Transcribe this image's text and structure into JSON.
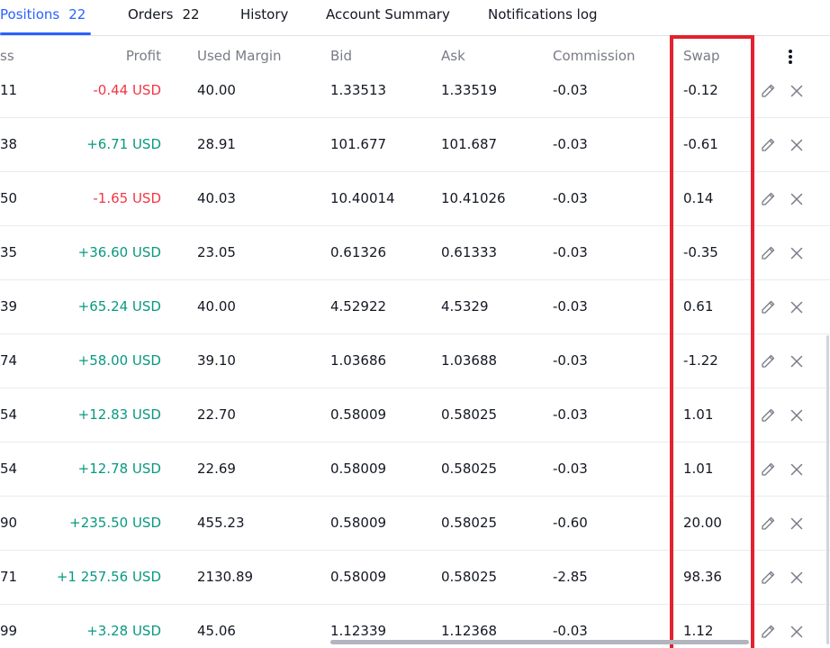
{
  "tabs": [
    {
      "label": "Positions",
      "count": "22"
    },
    {
      "label": "Orders",
      "count": "22"
    },
    {
      "label": "History"
    },
    {
      "label": "Account Summary"
    },
    {
      "label": "Notifications log"
    }
  ],
  "columns": {
    "loss": "ss",
    "profit": "Profit",
    "used_margin": "Used Margin",
    "bid": "Bid",
    "ask": "Ask",
    "commission": "Commission",
    "swap": "Swap"
  },
  "rows": [
    {
      "loss": "11",
      "profit": "-0.44 USD",
      "used_margin": "40.00",
      "bid": "1.33513",
      "ask": "1.33519",
      "commission": "-0.03",
      "swap": "-0.12"
    },
    {
      "loss": "38",
      "profit": "+6.71 USD",
      "used_margin": "28.91",
      "bid": "101.677",
      "ask": "101.687",
      "commission": "-0.03",
      "swap": "-0.61"
    },
    {
      "loss": "50",
      "profit": "-1.65 USD",
      "used_margin": "40.03",
      "bid": "10.40014",
      "ask": "10.41026",
      "commission": "-0.03",
      "swap": "0.14"
    },
    {
      "loss": "35",
      "profit": "+36.60 USD",
      "used_margin": "23.05",
      "bid": "0.61326",
      "ask": "0.61333",
      "commission": "-0.03",
      "swap": "-0.35"
    },
    {
      "loss": "39",
      "profit": "+65.24 USD",
      "used_margin": "40.00",
      "bid": "4.52922",
      "ask": "4.5329",
      "commission": "-0.03",
      "swap": "0.61"
    },
    {
      "loss": "74",
      "profit": "+58.00 USD",
      "used_margin": "39.10",
      "bid": "1.03686",
      "ask": "1.03688",
      "commission": "-0.03",
      "swap": "-1.22"
    },
    {
      "loss": "54",
      "profit": "+12.83 USD",
      "used_margin": "22.70",
      "bid": "0.58009",
      "ask": "0.58025",
      "commission": "-0.03",
      "swap": "1.01"
    },
    {
      "loss": "54",
      "profit": "+12.78 USD",
      "used_margin": "22.69",
      "bid": "0.58009",
      "ask": "0.58025",
      "commission": "-0.03",
      "swap": "1.01"
    },
    {
      "loss": "90",
      "profit": "+235.50 USD",
      "used_margin": "455.23",
      "bid": "0.58009",
      "ask": "0.58025",
      "commission": "-0.60",
      "swap": "20.00"
    },
    {
      "loss": "71",
      "profit": "+1 257.56 USD",
      "used_margin": "2130.89",
      "bid": "0.58009",
      "ask": "0.58025",
      "commission": "-2.85",
      "swap": "98.36"
    },
    {
      "loss": "99",
      "profit": "+3.28 USD",
      "used_margin": "45.06",
      "bid": "1.12339",
      "ask": "1.12368",
      "commission": "-0.03",
      "swap": "1.12"
    }
  ],
  "icons": {
    "edit": "pencil-icon",
    "close": "close-icon",
    "menu": "more-vertical-icon"
  },
  "colors": {
    "accent": "#2962ff",
    "positive": "#089981",
    "negative": "#f23645",
    "highlight": "#e3212f",
    "muted": "#787b86"
  }
}
